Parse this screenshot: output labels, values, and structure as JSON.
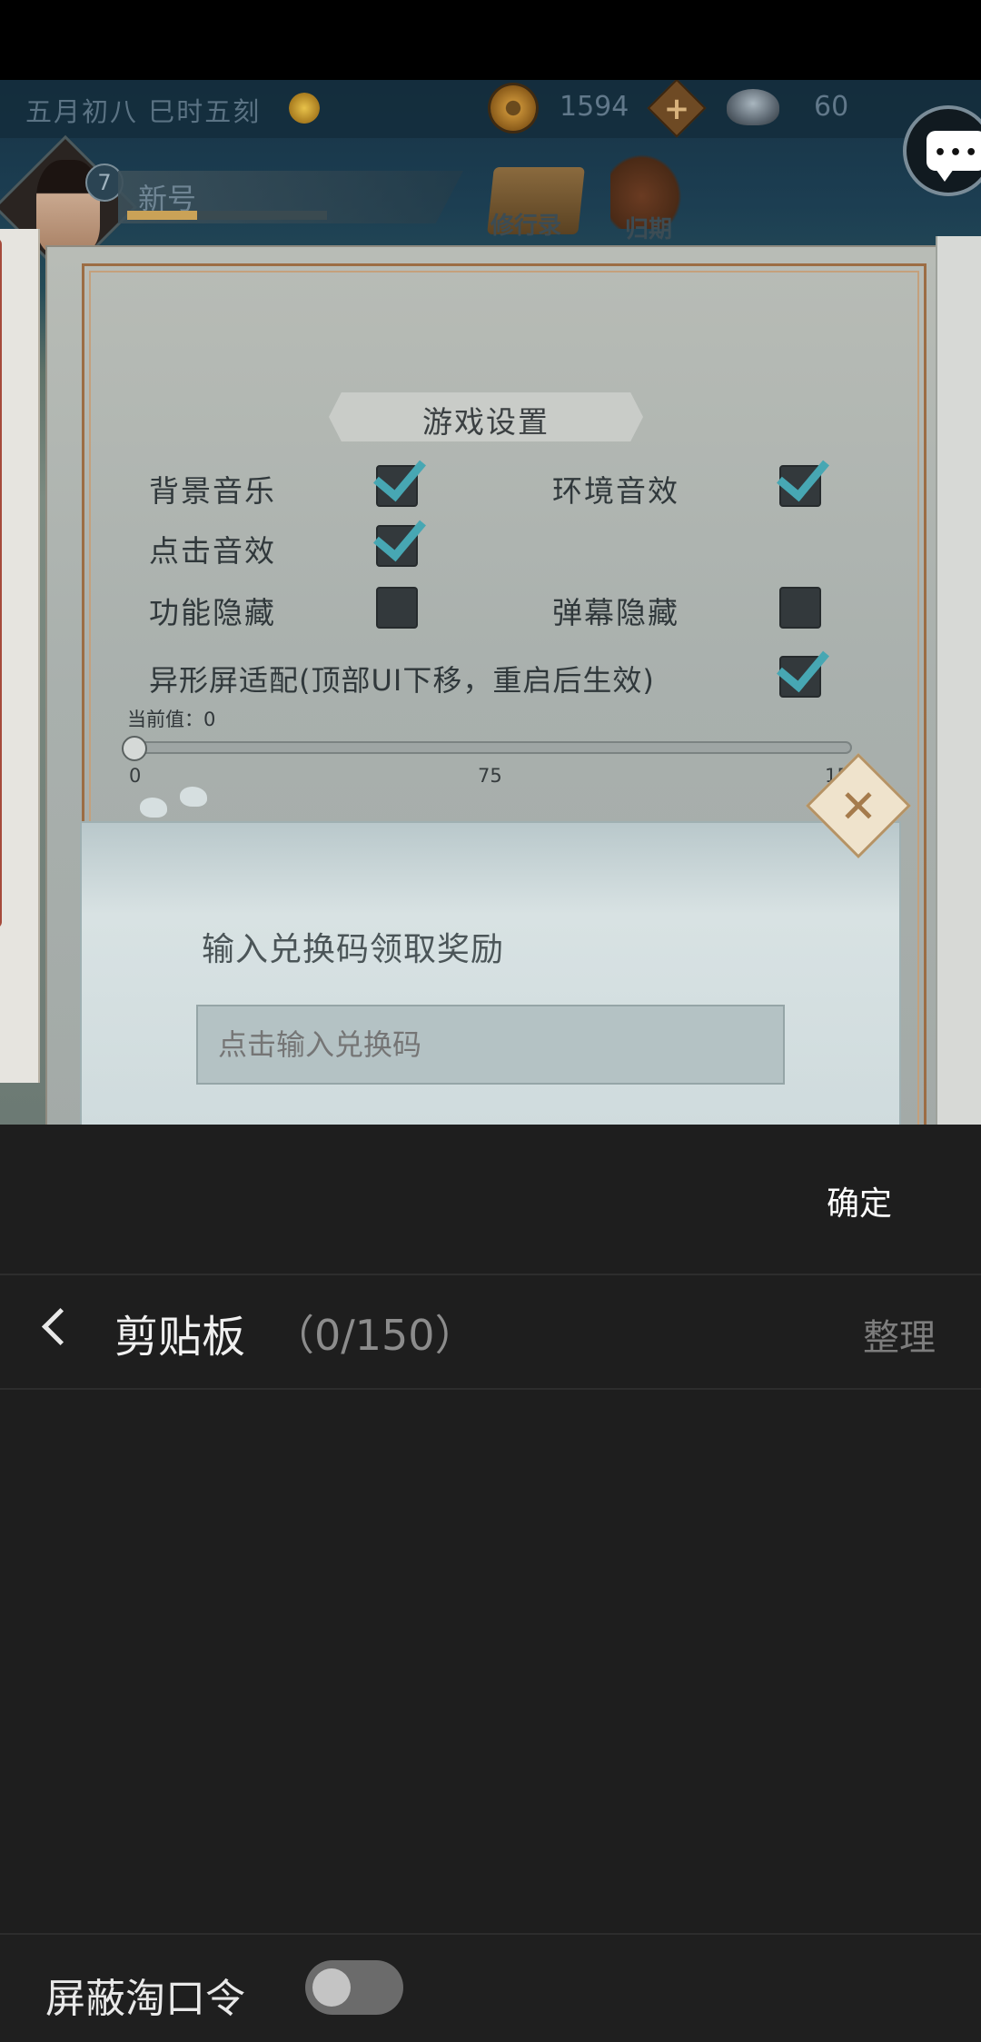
{
  "game": {
    "date_text": "五月初八 巳时五刻",
    "coins": "1594",
    "ingots": "60",
    "player": {
      "level": "7",
      "name": "新号"
    },
    "menu": {
      "journal_label": "修行录",
      "return_label": "归期"
    }
  },
  "settings": {
    "title": "游戏设置",
    "options": {
      "bgm": {
        "label": "背景音乐",
        "checked": true
      },
      "ambient": {
        "label": "环境音效",
        "checked": true
      },
      "click_sfx": {
        "label": "点击音效",
        "checked": true
      },
      "hide_functions": {
        "label": "功能隐藏",
        "checked": false
      },
      "hide_danmaku": {
        "label": "弹幕隐藏",
        "checked": false
      },
      "notch_adapt": {
        "label": "异形屏适配(顶部UI下移，重启后生效)",
        "checked": true
      }
    },
    "slider": {
      "current_label": "当前值：0",
      "value": 0,
      "min_label": "0",
      "mid_label": "75",
      "max_label": "15"
    }
  },
  "redeem": {
    "title": "输入兑换码领取奖励",
    "placeholder": "点击输入兑换码",
    "close_symbol": "✕"
  },
  "clipboard": {
    "confirm_label": "确定",
    "title": "剪贴板",
    "count": "（0/150）",
    "organize_label": "整理",
    "block_taobao_label": "屏蔽淘口令",
    "block_taobao_on": false
  },
  "colors": {
    "check_accent": "#47a7b3",
    "panel_bg": "#1e1e1e"
  }
}
